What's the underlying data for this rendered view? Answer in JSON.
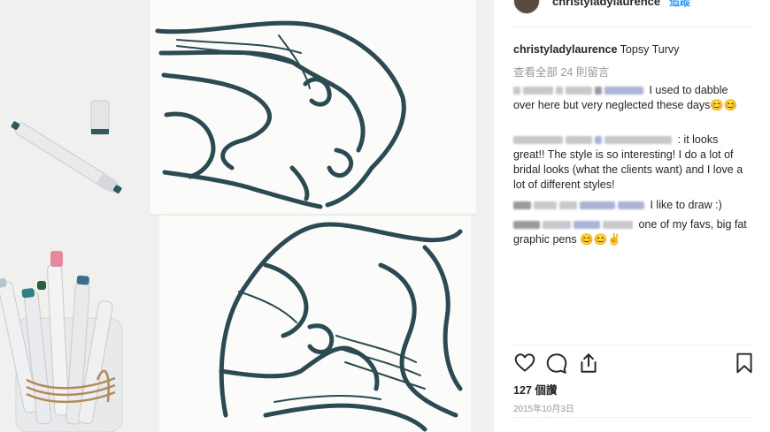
{
  "header": {
    "username": "christyladylaurence",
    "follow_label": "追蹤"
  },
  "caption": {
    "username": "christyladylaurence",
    "text": "Topsy Turvy"
  },
  "view_all_comments": "查看全部 24 則留言",
  "comments": [
    {
      "user": "",
      "text": "I used to dabble over here but very neglected these days😊😊"
    },
    {
      "user": "",
      "text": ": it looks great!! The style is so interesting! I do a lot of bridal looks (what the clients want) and I love a lot of different styles!"
    },
    {
      "user": "",
      "text": "I like to draw :)"
    },
    {
      "user": "",
      "text": "one of my favs, big fat graphic pens 😊😊✌"
    }
  ],
  "actions": {
    "like_icon": "heart-icon",
    "comment_icon": "comment-icon",
    "share_icon": "share-icon",
    "save_icon": "bookmark-icon"
  },
  "likes": "127 個讚",
  "date": "2015年10月3日",
  "colors": {
    "ink": "#2b4a52",
    "accent": "#3897f0",
    "muted": "#999999",
    "marker_pink": "#e48a9c",
    "marker_teal": "#2f7f86"
  }
}
